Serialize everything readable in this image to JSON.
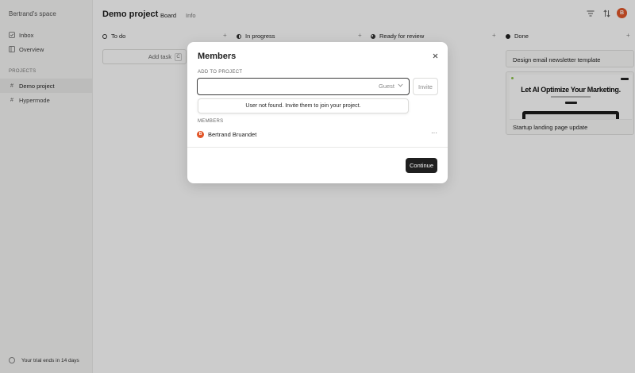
{
  "sidebar": {
    "workspace_title": "Bertrand's space",
    "nav": [
      {
        "label": "Inbox",
        "icon": "inbox-icon"
      },
      {
        "label": "Overview",
        "icon": "overview-icon"
      }
    ],
    "projects_label": "PROJECTS",
    "projects": [
      {
        "label": "Demo project",
        "icon": "hash-icon",
        "active": true
      },
      {
        "label": "Hypermode",
        "icon": "hash-icon",
        "active": false
      }
    ],
    "trial_text": "Your trial ends in 14 days"
  },
  "header": {
    "title": "Demo project",
    "tabs": [
      {
        "label": "Board",
        "active": true
      },
      {
        "label": "Info",
        "active": false
      }
    ],
    "avatar_initial": "B"
  },
  "board": {
    "columns": [
      {
        "label": "To do",
        "status_icon": "circle-empty-icon"
      },
      {
        "label": "In progress",
        "status_icon": "circle-half-icon"
      },
      {
        "label": "Ready for review",
        "status_icon": "circle-three-quarter-icon"
      },
      {
        "label": "Done",
        "status_icon": "circle-filled-icon"
      }
    ],
    "add_task_label": "Add task",
    "add_task_shortcut": "C",
    "done_cards": [
      {
        "title": "Design email newsletter template"
      },
      {
        "title": "Startup landing page update",
        "thumbnail_headline": "Let AI Optimize Your Marketing."
      }
    ]
  },
  "modal": {
    "title": "Members",
    "add_to_project_label": "ADD TO PROJECT",
    "input_value": "",
    "role_value": "Guest",
    "invite_label": "Invite",
    "error_message": "User not found. Invite them to join your project.",
    "members_label": "MEMBERS",
    "members": [
      {
        "name": "Bertrand Bruandet",
        "initial": "B"
      }
    ],
    "continue_label": "Continue"
  },
  "colors": {
    "accent_avatar": "#e2572a",
    "primary_button": "#1f1f1f",
    "sidebar_bg": "#f7f7f6"
  }
}
